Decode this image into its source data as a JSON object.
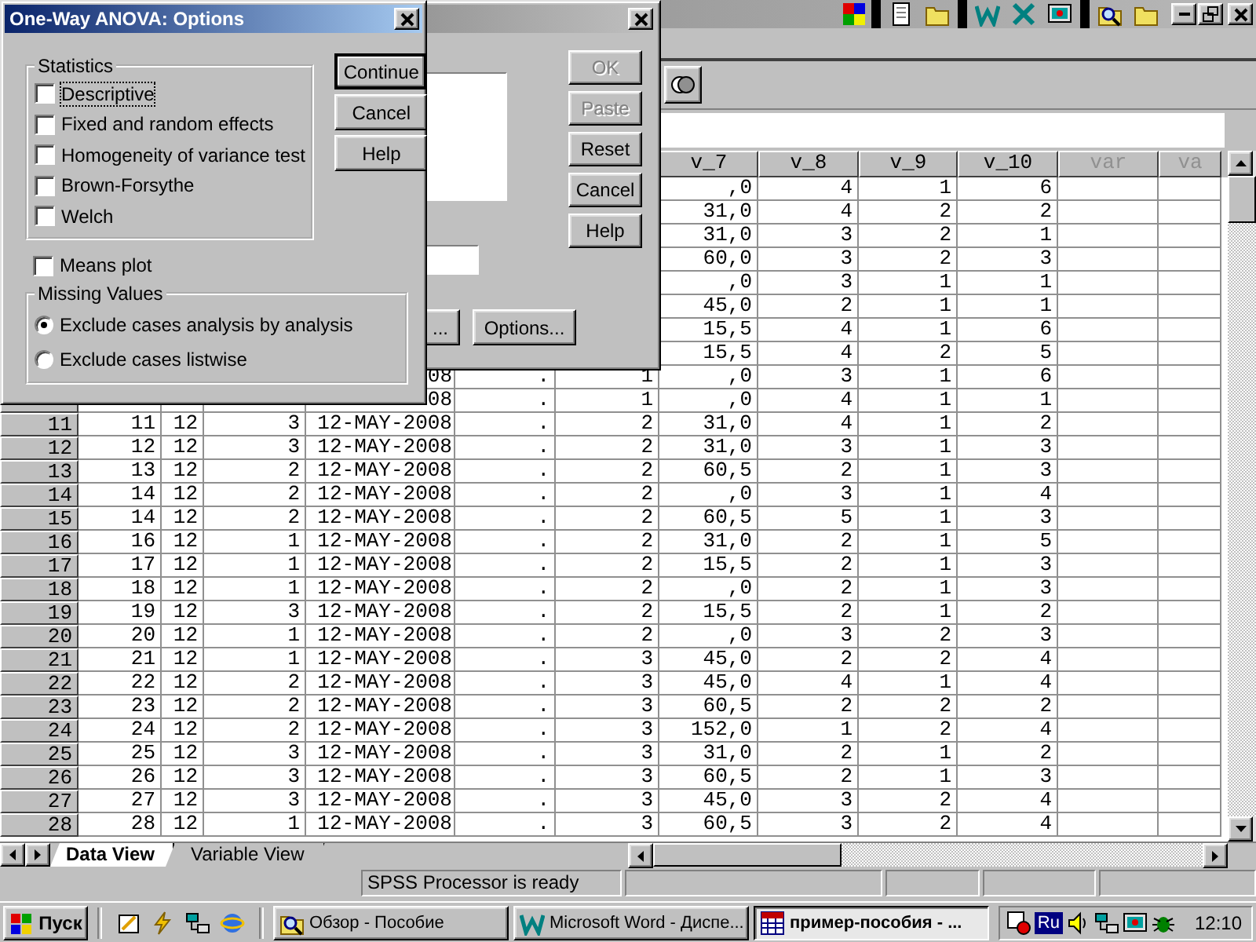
{
  "options_dialog": {
    "title": "One-Way ANOVA: Options",
    "statistics": {
      "label": "Statistics",
      "options": [
        {
          "label": "Descriptive",
          "checked": false,
          "focused": true
        },
        {
          "label": "Fixed and random effects",
          "checked": false,
          "focused": false
        },
        {
          "label": "Homogeneity of variance test",
          "checked": false,
          "focused": false
        },
        {
          "label": "Brown-Forsythe",
          "checked": false,
          "focused": false
        },
        {
          "label": "Welch",
          "checked": false,
          "focused": false
        }
      ]
    },
    "means_plot": {
      "label": "Means plot",
      "checked": false
    },
    "missing_values": {
      "label": "Missing Values",
      "options": [
        {
          "label": "Exclude cases analysis by analysis",
          "selected": true
        },
        {
          "label": "Exclude cases listwise",
          "selected": false
        }
      ]
    },
    "buttons": [
      {
        "label": "Continue",
        "default": true
      },
      {
        "label": "Cancel",
        "default": false
      },
      {
        "label": "Help",
        "default": false
      }
    ]
  },
  "main_dialog": {
    "buttons": [
      {
        "label": "OK",
        "disabled": true
      },
      {
        "label": "Paste",
        "disabled": true
      },
      {
        "label": "Reset",
        "disabled": false
      },
      {
        "label": "Cancel",
        "disabled": false
      },
      {
        "label": "Help",
        "disabled": false
      }
    ],
    "bottom_buttons": [
      "...",
      "Options..."
    ]
  },
  "grid": {
    "columns": [
      {},
      {},
      {},
      {},
      {},
      {},
      {
        "label": "v_7",
        "empty": false
      },
      {
        "label": "v_8",
        "empty": false
      },
      {
        "label": "v_9",
        "empty": false
      },
      {
        "label": "v_10",
        "empty": false
      },
      {
        "label": "var",
        "empty": true
      },
      {
        "label": "va",
        "empty": true
      }
    ],
    "rows": [
      {
        "header": null,
        "cells": [
          null,
          null,
          null,
          null,
          null,
          null,
          ",0",
          "4",
          "1",
          "6"
        ]
      },
      {
        "header": null,
        "cells": [
          null,
          null,
          null,
          null,
          null,
          null,
          "31,0",
          "4",
          "2",
          "2"
        ]
      },
      {
        "header": null,
        "cells": [
          null,
          null,
          null,
          null,
          null,
          null,
          "31,0",
          "3",
          "2",
          "1"
        ]
      },
      {
        "header": null,
        "cells": [
          null,
          null,
          null,
          null,
          null,
          null,
          "60,0",
          "3",
          "2",
          "3"
        ]
      },
      {
        "header": null,
        "cells": [
          null,
          null,
          null,
          null,
          null,
          null,
          ",0",
          "3",
          "1",
          "1"
        ]
      },
      {
        "header": null,
        "cells": [
          null,
          null,
          null,
          null,
          null,
          null,
          "45,0",
          "2",
          "1",
          "1"
        ]
      },
      {
        "header": null,
        "cells": [
          null,
          null,
          null,
          null,
          null,
          null,
          "15,5",
          "4",
          "1",
          "6"
        ]
      },
      {
        "header": null,
        "cells": [
          null,
          null,
          null,
          null,
          null,
          null,
          "15,5",
          "4",
          "2",
          "5"
        ]
      },
      {
        "header": null,
        "cells": [
          null,
          null,
          null,
          "08",
          ".",
          "1",
          ",0",
          "3",
          "1",
          "6"
        ]
      },
      {
        "header": null,
        "cells": [
          null,
          null,
          null,
          "08",
          ".",
          "1",
          ",0",
          "4",
          "1",
          "1"
        ]
      },
      {
        "header": "11",
        "cells": [
          "11",
          "12",
          "3",
          "12-MAY-2008",
          ".",
          "2",
          "31,0",
          "4",
          "1",
          "2"
        ]
      },
      {
        "header": "12",
        "cells": [
          "12",
          "12",
          "3",
          "12-MAY-2008",
          ".",
          "2",
          "31,0",
          "3",
          "1",
          "3"
        ]
      },
      {
        "header": "13",
        "cells": [
          "13",
          "12",
          "2",
          "12-MAY-2008",
          ".",
          "2",
          "60,5",
          "2",
          "1",
          "3"
        ]
      },
      {
        "header": "14",
        "cells": [
          "14",
          "12",
          "2",
          "12-MAY-2008",
          ".",
          "2",
          ",0",
          "3",
          "1",
          "4"
        ]
      },
      {
        "header": "15",
        "cells": [
          "14",
          "12",
          "2",
          "12-MAY-2008",
          ".",
          "2",
          "60,5",
          "5",
          "1",
          "3"
        ]
      },
      {
        "header": "16",
        "cells": [
          "16",
          "12",
          "1",
          "12-MAY-2008",
          ".",
          "2",
          "31,0",
          "2",
          "1",
          "5"
        ]
      },
      {
        "header": "17",
        "cells": [
          "17",
          "12",
          "1",
          "12-MAY-2008",
          ".",
          "2",
          "15,5",
          "2",
          "1",
          "3"
        ]
      },
      {
        "header": "18",
        "cells": [
          "18",
          "12",
          "1",
          "12-MAY-2008",
          ".",
          "2",
          ",0",
          "2",
          "1",
          "3"
        ]
      },
      {
        "header": "19",
        "cells": [
          "19",
          "12",
          "3",
          "12-MAY-2008",
          ".",
          "2",
          "15,5",
          "2",
          "1",
          "2"
        ]
      },
      {
        "header": "20",
        "cells": [
          "20",
          "12",
          "1",
          "12-MAY-2008",
          ".",
          "2",
          ",0",
          "3",
          "2",
          "3"
        ]
      },
      {
        "header": "21",
        "cells": [
          "21",
          "12",
          "1",
          "12-MAY-2008",
          ".",
          "3",
          "45,0",
          "2",
          "2",
          "4"
        ]
      },
      {
        "header": "22",
        "cells": [
          "22",
          "12",
          "2",
          "12-MAY-2008",
          ".",
          "3",
          "45,0",
          "4",
          "1",
          "4"
        ]
      },
      {
        "header": "23",
        "cells": [
          "23",
          "12",
          "2",
          "12-MAY-2008",
          ".",
          "3",
          "60,5",
          "2",
          "2",
          "2"
        ]
      },
      {
        "header": "24",
        "cells": [
          "24",
          "12",
          "2",
          "12-MAY-2008",
          ".",
          "3",
          "152,0",
          "1",
          "2",
          "4"
        ]
      },
      {
        "header": "25",
        "cells": [
          "25",
          "12",
          "3",
          "12-MAY-2008",
          ".",
          "3",
          "31,0",
          "2",
          "1",
          "2"
        ]
      },
      {
        "header": "26",
        "cells": [
          "26",
          "12",
          "3",
          "12-MAY-2008",
          ".",
          "3",
          "60,5",
          "2",
          "1",
          "3"
        ]
      },
      {
        "header": "27",
        "cells": [
          "27",
          "12",
          "3",
          "12-MAY-2008",
          ".",
          "3",
          "45,0",
          "3",
          "2",
          "4"
        ]
      },
      {
        "header": "28",
        "cells": [
          "28",
          "12",
          "1",
          "12-MAY-2008",
          ".",
          "3",
          "60,5",
          "3",
          "2",
          "4"
        ]
      }
    ]
  },
  "tabs": [
    {
      "label": "Data View",
      "selected": true
    },
    {
      "label": "Variable View",
      "selected": false
    }
  ],
  "status_bar": {
    "message": "SPSS Processor  is ready"
  },
  "taskbar": {
    "start": "Пуск",
    "tasks": [
      {
        "label": "Обзор - Пособие",
        "selected": false
      },
      {
        "label": "Microsoft Word - Диспе...",
        "selected": false
      },
      {
        "label": "пример-пособия - ...",
        "selected": true
      }
    ],
    "language": "Ru",
    "clock": "12:10"
  }
}
